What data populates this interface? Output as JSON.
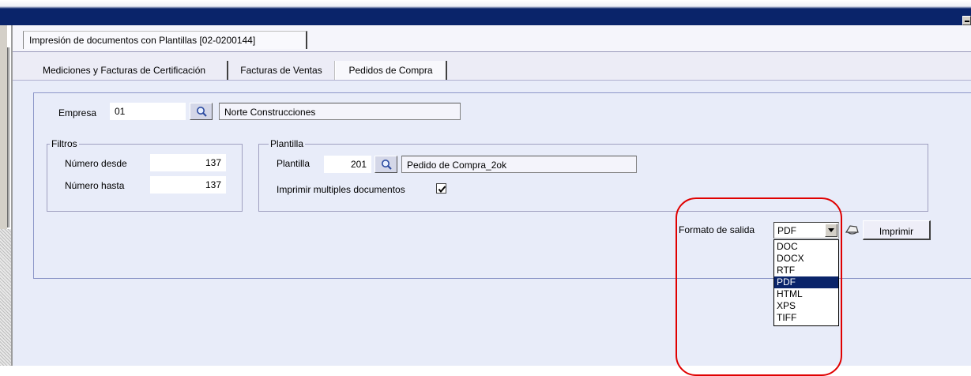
{
  "window": {
    "doc_tab_title": "Impresión de documentos con Plantillas [02-0200144]"
  },
  "tabs": [
    {
      "label": "Mediciones y Facturas de Certificación"
    },
    {
      "label": "Facturas de Ventas"
    },
    {
      "label": "Pedidos de Compra"
    }
  ],
  "empresa": {
    "label": "Empresa",
    "code": "01",
    "name": "Norte Construcciones"
  },
  "filtros": {
    "legend": "Filtros",
    "desde_label": "Número desde",
    "desde_value": "137",
    "hasta_label": "Número hasta",
    "hasta_value": "137"
  },
  "plantilla": {
    "legend": "Plantilla",
    "label": "Plantilla",
    "code": "201",
    "name": "Pedido de Compra_2ok",
    "multiple_label": "Imprimir multiples documentos",
    "multiple_checked": true
  },
  "output": {
    "format_label": "Formato de salida",
    "selected": "PDF",
    "options": [
      "DOC",
      "DOCX",
      "RTF",
      "PDF",
      "HTML",
      "XPS",
      "TIFF"
    ],
    "print_label": "Imprimir"
  },
  "colors": {
    "titlebar": "#0a246a",
    "panel": "#e8ecf9",
    "highlight": "#0a246a",
    "annotation": "#e00000"
  }
}
